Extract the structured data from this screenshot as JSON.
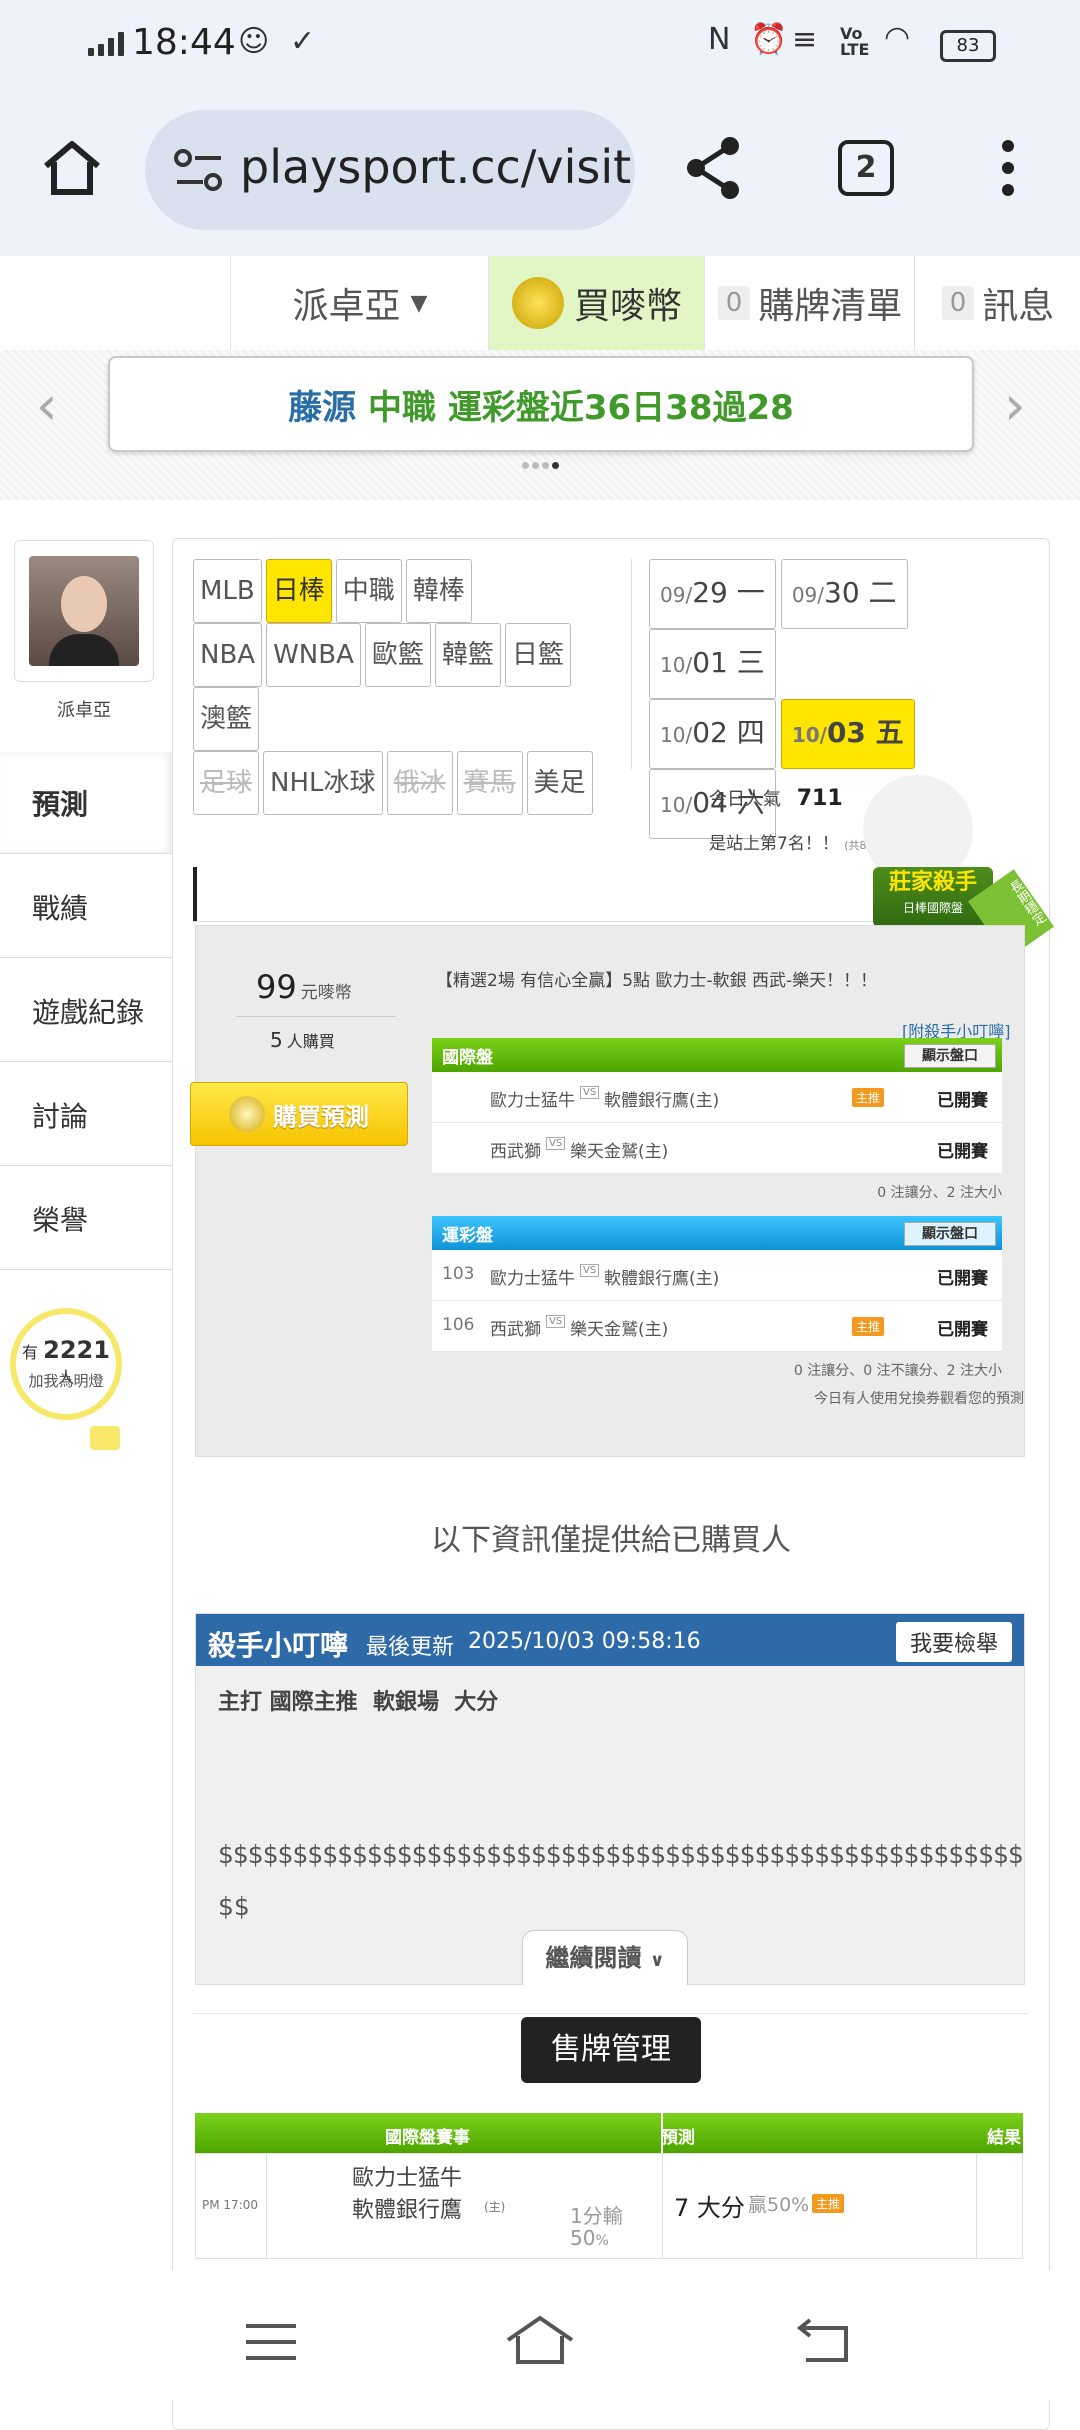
{
  "status_bar": {
    "time": "18:44",
    "battery": "83"
  },
  "browser": {
    "url": "playsport.cc/visit",
    "tab_count": "2"
  },
  "top_nav": {
    "user": "派卓亞",
    "buy_coins": "買嘜幣",
    "cart_count": "0",
    "cart": "購牌清單",
    "msg_count": "0",
    "messages": "訊息"
  },
  "banner": {
    "part1": "藤源",
    "part2": "中職",
    "part3": "運彩盤近36日38過28"
  },
  "profile": {
    "name": "派卓亞",
    "fans_prefix": "有",
    "fans_count": "2221",
    "fans_suffix": "人",
    "follow_text": "加我為明燈"
  },
  "side_nav": [
    {
      "label": "預測"
    },
    {
      "label": "戰績"
    },
    {
      "label": "遊戲紀錄"
    },
    {
      "label": "討論"
    },
    {
      "label": "榮譽"
    }
  ],
  "sport_tags": [
    "MLB",
    "日棒",
    "中職",
    "韓棒",
    "NBA",
    "WNBA",
    "歐籃",
    "韓籃",
    "日籃",
    "澳籃",
    "足球",
    "NHL冰球",
    "俄冰",
    "賽馬",
    "美足"
  ],
  "dates": [
    {
      "m": "09/",
      "d": "29 一"
    },
    {
      "m": "09/",
      "d": "30 二"
    },
    {
      "m": "10/",
      "d": "01 三"
    },
    {
      "m": "10/",
      "d": "02 四"
    },
    {
      "m": "10/",
      "d": "03 五"
    },
    {
      "m": "10/",
      "d": "04 六"
    }
  ],
  "popularity": {
    "label": "今日人氣",
    "value": "711",
    "rank_text": "是站上第7名！！",
    "total": "(共8056人)"
  },
  "badge": {
    "title": "莊家殺手",
    "sub": "日棒國際盤",
    "ribbon": "長期穩定"
  },
  "prediction": {
    "price": "99",
    "price_unit": "元嘜幣",
    "buyers": "5",
    "buyers_unit": "人購買",
    "buy_label": "購買預測",
    "headline": "【精選2場 有信心全贏】5點 歐力士-軟銀 西武-樂天！！！",
    "tip_link": "[附殺手小叮嚀]",
    "intl_title": "國際盤",
    "show_odds": "顯示盤口",
    "started": "已開賽",
    "vs": "VS",
    "home": "主推",
    "intl_rows": [
      {
        "away": "歐力士猛牛",
        "home_team": "軟體銀行鷹(主)"
      },
      {
        "away": "西武獅",
        "home_team": "樂天金鷲(主)"
      }
    ],
    "intl_summary": "0 注讓分、2 注大小",
    "lottery_title": "運彩盤",
    "lottery_rows": [
      {
        "no": "103",
        "away": "歐力士猛牛",
        "home_team": "軟體銀行鷹(主)"
      },
      {
        "no": "106",
        "away": "西武獅",
        "home_team": "樂天金鷲(主)"
      }
    ],
    "lottery_summary": "0 注讓分、0 注不讓分、2 注大小",
    "voucher_text": "今日有人使用兌換券觀看您的預測"
  },
  "buyers_only": "以下資訊僅提供給已購買人",
  "killer_note": {
    "title": "殺手小叮嚀",
    "updated_label": "最後更新",
    "updated": "2025/10/03 09:58:16",
    "report": "我要檢舉",
    "text": "主打 國際主推  軟銀場  大分",
    "dollars1": "$$$$$$$$$$$$$$$$$$$$$$$$$$$$$$$$$$$$$$$$$$$$$$$$$$$$$$",
    "dollars2": "$$",
    "continue": "繼續閱讀"
  },
  "sell_manage": "售牌管理",
  "sell_table": {
    "col1": "國際盤賽事",
    "col2": "預測",
    "col3": "結果",
    "row": {
      "time": "PM 17:00",
      "away": "歐力士猛牛",
      "home_team": "軟體銀行鷹",
      "home_mark": "(主)",
      "spread": "1分輸",
      "spread_pct": "50",
      "pct_unit": "%",
      "pick": "7 大分",
      "win": "贏50%",
      "tag": "主推"
    }
  },
  "colors": {
    "green": "#5cb800",
    "blue": "#1aa5e6",
    "yellow": "#ffe600",
    "navy": "#2f6aa8"
  }
}
